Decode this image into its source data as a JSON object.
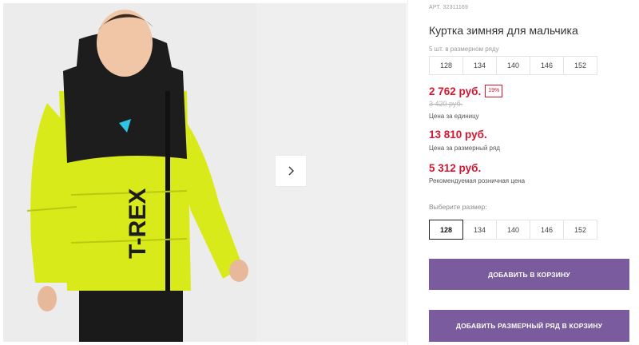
{
  "product": {
    "article": "АРТ. 32311169",
    "title": "Куртка зимняя для мальчика",
    "pack_label": "5 шт. в размерном ряду",
    "pack_sizes": [
      "128",
      "134",
      "140",
      "146",
      "152"
    ],
    "price_unit": "2 762 руб.",
    "discount": "19%",
    "old_price": "3 420 руб.",
    "price_unit_caption": "Цена за единицу",
    "price_pack": "13 810 руб.",
    "price_pack_caption": "Цена за размерный ряд",
    "price_retail": "5 312 руб.",
    "price_retail_caption": "Рекомендуемая розничная цена",
    "choose_size_label": "Выберите размер:",
    "select_sizes": [
      "128",
      "134",
      "140",
      "146",
      "152"
    ],
    "selected_size": "128"
  },
  "actions": {
    "add_to_cart": "ДОБАВИТЬ В КОРЗИНУ",
    "add_pack_to_cart": "ДОБАВИТЬ РАЗМЕРНЫЙ РЯД В КОРЗИНУ"
  },
  "photo": {
    "print_text": "T-REX"
  },
  "colors": {
    "accent_button": "#7a5c9e",
    "price_red": "#d6162f",
    "jacket_yellow": "#d9ea1a"
  },
  "icons": {
    "next": "chevron-right-icon"
  }
}
